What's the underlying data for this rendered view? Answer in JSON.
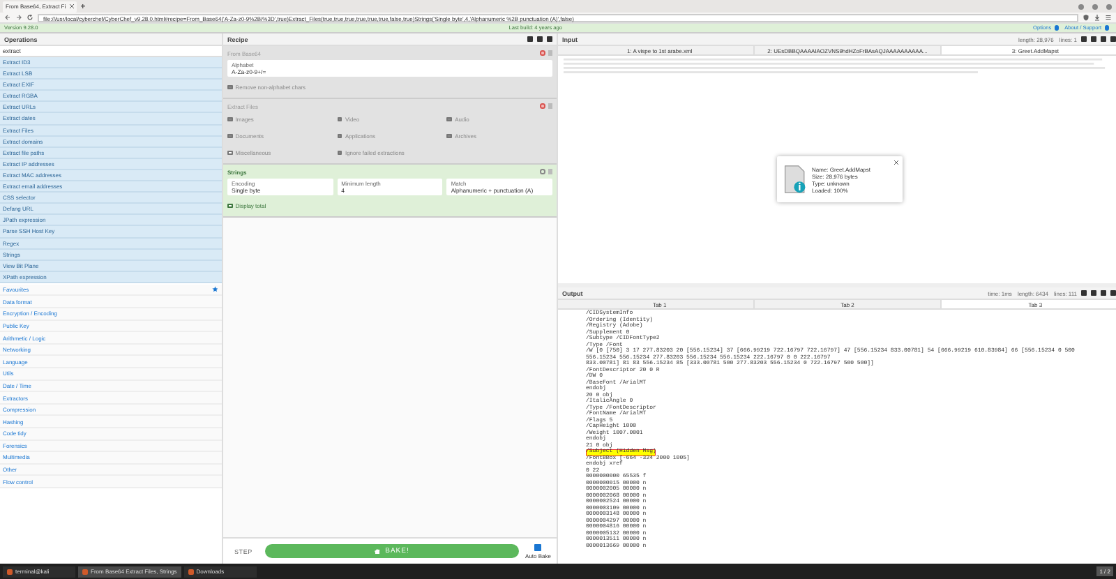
{
  "browser": {
    "tab": "From Base64, Extract Fi",
    "url": "file:///usr/local/cyberchef/CyberChef_v9.28.0.html#recipe=From_Base64('A-Za-z0-9%2B/%3D',true)Extract_Files(true,true,true,true,true,true,false,true)Strings('Single byte',4,'Alphanumeric %2B punctuation (A)',false)"
  },
  "banner": {
    "version": "Version 9.28.0",
    "build": "Last build: 4 years ago",
    "links": [
      "Options",
      "About / Support"
    ]
  },
  "operations": {
    "title": "Operations",
    "search": "extract",
    "results": [
      "Extract ID3",
      "Extract LSB",
      "Extract EXIF",
      "Extract RGBA",
      "Extract URLs",
      "Extract dates",
      "Extract Files",
      "Extract domains",
      "Extract file paths",
      "Extract IP addresses",
      "Extract MAC addresses",
      "Extract email addresses",
      "CSS selector",
      "Defang URL",
      "JPath expression",
      "Parse SSH Host Key",
      "Regex",
      "Strings",
      "View Bit Plane",
      "XPath expression"
    ],
    "categories": [
      {
        "label": "Favourites",
        "kind": "favourites"
      },
      {
        "label": "Data format",
        "kind": "plain"
      },
      {
        "label": "Encryption / Encoding",
        "kind": "plain"
      },
      {
        "label": "Public Key",
        "kind": "plain"
      },
      {
        "label": "Arithmetic / Logic",
        "kind": "plain"
      },
      {
        "label": "Networking",
        "kind": "plain"
      },
      {
        "label": "Language",
        "kind": "plain"
      },
      {
        "label": "Utils",
        "kind": "plain"
      },
      {
        "label": "Date / Time",
        "kind": "plain"
      },
      {
        "label": "Extractors",
        "kind": "plain"
      },
      {
        "label": "Compression",
        "kind": "plain"
      },
      {
        "label": "Hashing",
        "kind": "plain"
      },
      {
        "label": "Code tidy",
        "kind": "plain"
      },
      {
        "label": "Forensics",
        "kind": "plain"
      },
      {
        "label": "Multimedia",
        "kind": "plain"
      },
      {
        "label": "Other",
        "kind": "plain"
      },
      {
        "label": "Flow control",
        "kind": "plain"
      }
    ]
  },
  "recipe": {
    "title": "Recipe",
    "ops": [
      {
        "name": "From Base64",
        "disabled": true,
        "args": [
          {
            "kind": "wide",
            "label": "Alphabet",
            "value": "A-Za-z0-9+/="
          },
          {
            "kind": "checkbox",
            "label": "Remove non-alphabet chars",
            "checked": true
          }
        ]
      },
      {
        "name": "Extract Files",
        "disabled": true,
        "args": [
          {
            "kind": "checkbox",
            "label": "Images",
            "checked": true
          },
          {
            "kind": "checkbox",
            "label": "Video",
            "checked": true
          },
          {
            "kind": "checkbox",
            "label": "Audio",
            "checked": true
          },
          {
            "kind": "checkbox",
            "label": "Documents",
            "checked": true
          },
          {
            "kind": "checkbox",
            "label": "Applications",
            "checked": true
          },
          {
            "kind": "checkbox",
            "label": "Archives",
            "checked": true
          },
          {
            "kind": "checkbox",
            "label": "Miscellaneous",
            "checked": false
          },
          {
            "kind": "checkbox",
            "label": "Ignore failed extractions",
            "checked": true
          }
        ]
      },
      {
        "name": "Strings",
        "disabled": false,
        "args": [
          {
            "kind": "field",
            "label": "Encoding",
            "value": "Single byte"
          },
          {
            "kind": "field",
            "label": "Minimum length",
            "value": "4"
          },
          {
            "kind": "field",
            "label": "Match",
            "value": "Alphanumeric + punctuation (A)"
          },
          {
            "kind": "checkbox",
            "label": "Display total",
            "checked": false
          }
        ]
      }
    ]
  },
  "controls": {
    "step": "STEP",
    "bake": "BAKE!",
    "auto_bake": {
      "label": "Auto Bake",
      "checked": true
    }
  },
  "input": {
    "title": "Input",
    "stats": [
      "length: 28,976",
      "lines: 1"
    ],
    "tabs": [
      {
        "label": "1: A vispe to 1st arabe.xml",
        "selected": false
      },
      {
        "label": "2: UEsDBBQAAAAIAOZVNS9hdHZoFrBAsAQJAAAAAAAAAA...",
        "selected": false
      },
      {
        "label": "3: Greet.AddMapst",
        "selected": true
      }
    ],
    "file": {
      "name": "Name: Greet.AddMapst",
      "size": "Size: 28,976 bytes",
      "type": "Type: unknown",
      "loaded": "Loaded: 100%"
    }
  },
  "output": {
    "title": "Output",
    "stats": [
      "time: 1ms",
      "length: 6434",
      "lines: 111"
    ],
    "tabs": [
      {
        "label": "Tab 1",
        "selected": false
      },
      {
        "label": "Tab 2",
        "selected": false
      },
      {
        "label": "Tab 3",
        "selected": true
      }
    ],
    "lines": [
      {
        "text": "/CIDSystemInfo",
        "highlighted": false
      },
      {
        "text": "/Ordering (Identity)",
        "highlighted": false
      },
      {
        "text": "/Registry (Adobe)",
        "highlighted": false
      },
      {
        "text": "/Supplement 0",
        "highlighted": false
      },
      {
        "text": "/Subtype /CIDFontType2",
        "highlighted": false
      },
      {
        "text": "/Type /Font",
        "highlighted": false
      },
      {
        "text": "/W [0 [750] 3 17 277.83203 20 [556.15234] 37 [666.99219 722.16797 722.16797] 47 [556.15234 833.00781] 54 [666.99219 610.83984] 66 [556.15234 0 500 556.15234 556.15234 277.83203 556.15234 556.15234 222.16797 0 0 222.16797",
        "highlighted": false
      },
      {
        "text": "833.00781] 81 83 556.15234 85 [333.00781 500 277.83203 556.15234 0 722.16797 500 500]]",
        "highlighted": false
      },
      {
        "text": "/FontDescriptor 20 0 R",
        "highlighted": false
      },
      {
        "text": "/DW 0",
        "highlighted": false
      },
      {
        "text": "/BaseFont /ArialMT",
        "highlighted": false
      },
      {
        "text": "endobj",
        "highlighted": false
      },
      {
        "text": "20 0 obj",
        "highlighted": false
      },
      {
        "text": "/ItalicAngle 0",
        "highlighted": false
      },
      {
        "text": "/Type /FontDescriptor",
        "highlighted": false
      },
      {
        "text": "/FontName /ArialMT",
        "highlighted": false
      },
      {
        "text": "/Flags 5",
        "highlighted": false
      },
      {
        "text": "/CapHeight 1000",
        "highlighted": false
      },
      {
        "text": "/Weight 1007.0001",
        "highlighted": false
      },
      {
        "text": "endobj",
        "highlighted": false
      },
      {
        "text": "21 0 obj",
        "highlighted": false
      },
      {
        "text": "/Subject (Hidden Msg)",
        "highlighted": true
      },
      {
        "text": "/FontBBox [-664 -324 2000 1005]",
        "highlighted": false
      },
      {
        "text": "endobj xref",
        "highlighted": false
      },
      {
        "text": "0 22",
        "highlighted": false
      },
      {
        "text": "0000000000 65535 f",
        "highlighted": false
      },
      {
        "text": "0000000015 00000 n",
        "highlighted": false
      },
      {
        "text": "0000002005 00000 n",
        "highlighted": false
      },
      {
        "text": "0000002068 00000 n",
        "highlighted": false
      },
      {
        "text": "0000002524 00000 n",
        "highlighted": false
      },
      {
        "text": "0000003109 00000 n",
        "highlighted": false
      },
      {
        "text": "0000003148 00000 n",
        "highlighted": false
      },
      {
        "text": "0000004297 00000 n",
        "highlighted": false
      },
      {
        "text": "0000004816 00000 n",
        "highlighted": false
      },
      {
        "text": "0000005132 00000 n",
        "highlighted": false
      },
      {
        "text": "0000013511 00000 n",
        "highlighted": false
      },
      {
        "text": "0000013669 00000 n",
        "highlighted": false
      }
    ]
  },
  "taskbar": [
    {
      "label": "terminal@kali",
      "selected": false
    },
    {
      "label": "From Base64 Extract Files, Strings",
      "selected": true
    },
    {
      "label": "Downloads",
      "selected": false
    }
  ],
  "workspace": "1 / 2"
}
